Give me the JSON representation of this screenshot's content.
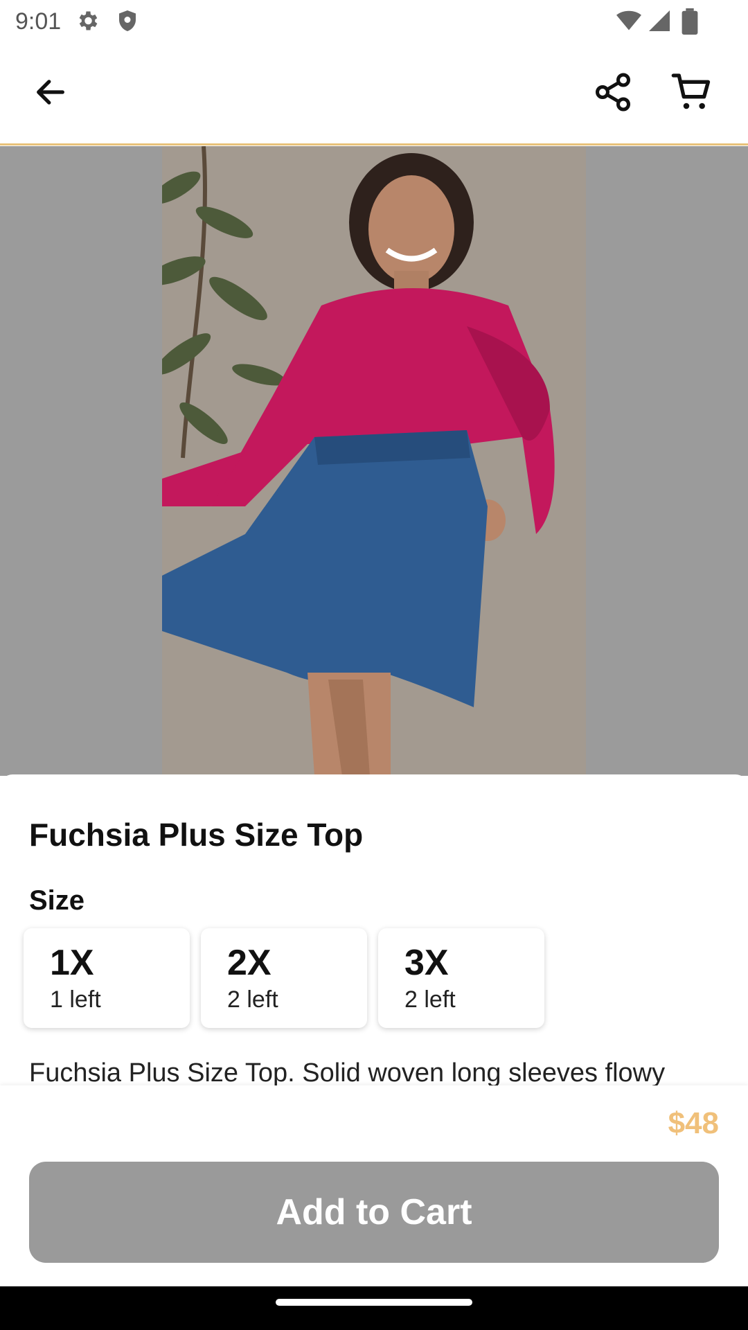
{
  "status_bar": {
    "time": "9:01",
    "icons_left": [
      "gear-icon",
      "shield-icon"
    ],
    "icons_right": [
      "wifi-icon",
      "signal-icon",
      "battery-icon"
    ]
  },
  "app_bar": {
    "back_icon": "arrow-left-icon",
    "share_icon": "share-icon",
    "cart_icon": "cart-icon"
  },
  "product": {
    "image_description_icon": "product-photo",
    "title": "Fuchsia Plus Size Top",
    "size_label": "Size",
    "sizes": [
      {
        "name": "1X",
        "stock": "1 left"
      },
      {
        "name": "2X",
        "stock": "2 left"
      },
      {
        "name": "3X",
        "stock": "2 left"
      }
    ],
    "description": "Fuchsia Plus Size Top. Solid woven long sleeves flowy"
  },
  "footer": {
    "price": "$48",
    "add_to_cart_label": "Add to Cart"
  },
  "colors": {
    "accent": "#e8c27a",
    "price": "#f0c07a",
    "button_disabled": "#9a9a9a",
    "image_backdrop": "#9b9b9b"
  }
}
